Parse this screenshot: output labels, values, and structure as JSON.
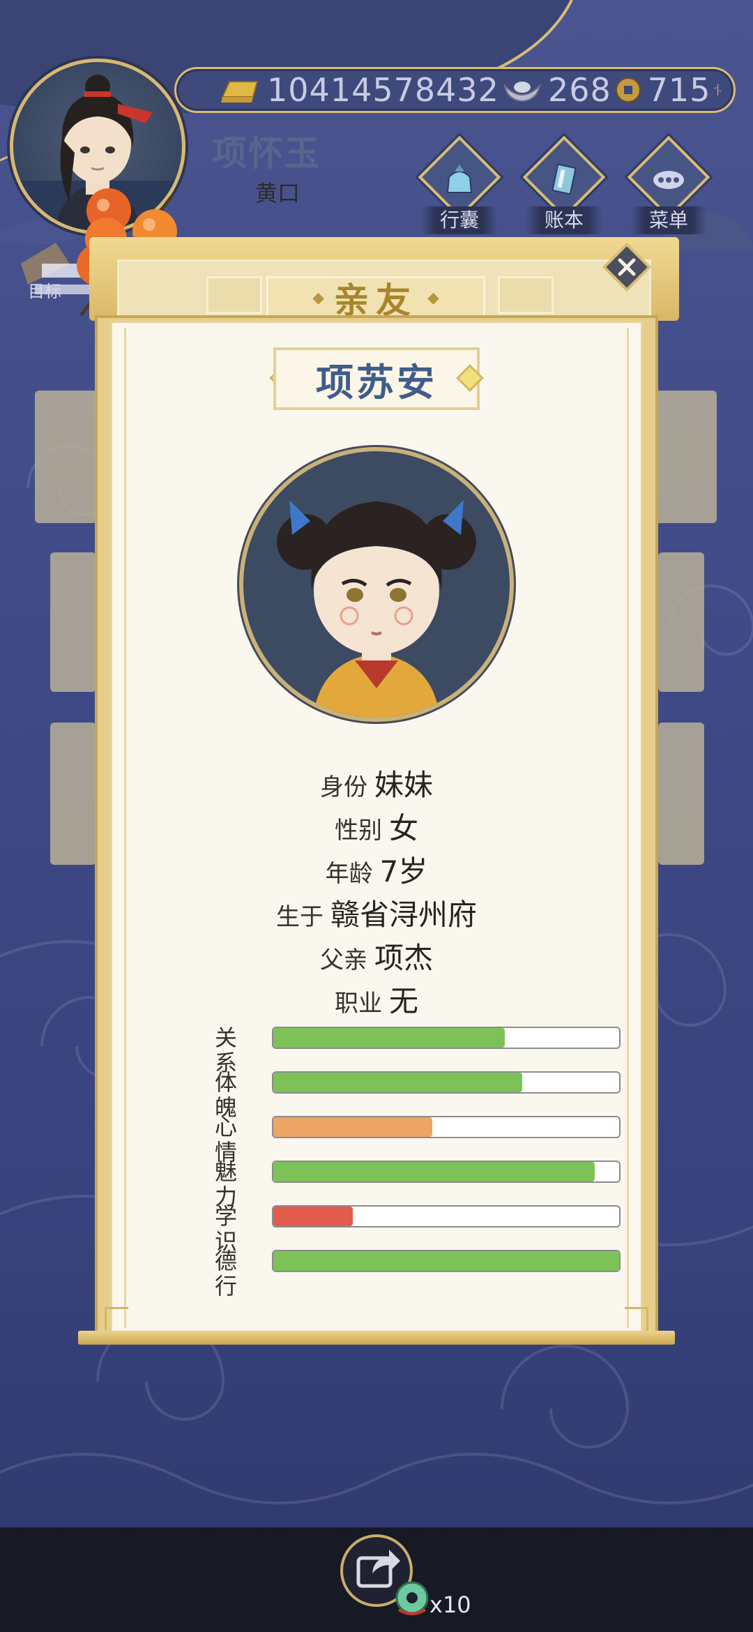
{
  "player": {
    "name": "项怀玉",
    "rank": "黄口"
  },
  "currency": {
    "gold": "10414578432",
    "silver": "268",
    "coin": "715"
  },
  "menu": [
    {
      "label": "行囊",
      "icon": "bag-icon"
    },
    {
      "label": "账本",
      "icon": "ledger-icon"
    },
    {
      "label": "菜单",
      "icon": "more-icon"
    }
  ],
  "goal_label": "目标",
  "panel": {
    "title": "亲友"
  },
  "relative": {
    "name": "项苏安",
    "fields": [
      {
        "key": "身份",
        "value": "妹妹"
      },
      {
        "key": "性别",
        "value": "女"
      },
      {
        "key": "年龄",
        "value": "7岁"
      },
      {
        "key": "生于",
        "value": "赣省浔州府"
      },
      {
        "key": "父亲",
        "value": "项杰"
      },
      {
        "key": "职业",
        "value": "无"
      }
    ],
    "stats": [
      {
        "key": "关系",
        "level": 0.67,
        "color": "#7dc257"
      },
      {
        "key": "体魄",
        "level": 0.72,
        "color": "#7dc257"
      },
      {
        "key": "心情",
        "level": 0.46,
        "color": "#eca565"
      },
      {
        "key": "魅力",
        "level": 0.93,
        "color": "#7dc257"
      },
      {
        "key": "学识",
        "level": 0.23,
        "color": "#e25b4b"
      },
      {
        "key": "德行",
        "level": 1.0,
        "color": "#7dc257"
      }
    ]
  },
  "share": {
    "count": "x10"
  }
}
